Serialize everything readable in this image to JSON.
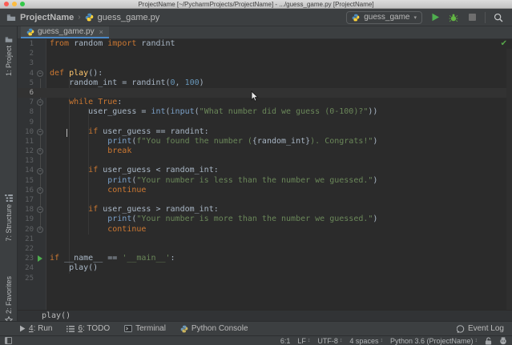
{
  "window": {
    "title": "ProjectName [~/PycharmProjects/ProjectName] - .../guess_game.py [ProjectName]"
  },
  "toolbar": {
    "project": "ProjectName",
    "separator": "›",
    "file": "guess_game.py",
    "run_config": "guess_game",
    "dropdown_caret": "▾"
  },
  "tabs": [
    {
      "label": "guess_game.py",
      "close": "×"
    }
  ],
  "left_bar": {
    "items": [
      "1: Project",
      "7: Structure",
      "2: Favorites"
    ]
  },
  "editor": {
    "caret_line": 6,
    "run_line": 23,
    "fold_start_lines": [
      4,
      7,
      10,
      14,
      18
    ],
    "fold_end_lines": [
      12,
      16,
      20
    ],
    "inspection_status": "✔",
    "breadcrumb": "play()",
    "lines": [
      {
        "tokens": [
          [
            "k",
            "from"
          ],
          [
            "t",
            " random "
          ],
          [
            "k",
            "import"
          ],
          [
            "t",
            " randint"
          ]
        ]
      },
      {
        "tokens": []
      },
      {
        "tokens": []
      },
      {
        "tokens": [
          [
            "k",
            "def"
          ],
          [
            "t",
            " "
          ],
          [
            "d",
            "play"
          ],
          [
            "t",
            "():"
          ]
        ]
      },
      {
        "tokens": [
          [
            "t",
            "    random_int = randint("
          ],
          [
            "n",
            "0"
          ],
          [
            "t",
            ", "
          ],
          [
            "n",
            "100"
          ],
          [
            "t",
            ")"
          ]
        ]
      },
      {
        "tokens": []
      },
      {
        "tokens": [
          [
            "t",
            "    "
          ],
          [
            "k",
            "while"
          ],
          [
            "t",
            " "
          ],
          [
            "k",
            "True"
          ],
          [
            "t",
            ":"
          ]
        ]
      },
      {
        "tokens": [
          [
            "t",
            "        user_guess = "
          ],
          [
            "b",
            "int"
          ],
          [
            "t",
            "("
          ],
          [
            "b",
            "input"
          ],
          [
            "t",
            "("
          ],
          [
            "s",
            "\"What number did we guess (0-100)?\""
          ],
          [
            "t",
            "))"
          ]
        ]
      },
      {
        "tokens": []
      },
      {
        "tokens": [
          [
            "t",
            "        "
          ],
          [
            "k",
            "if"
          ],
          [
            "t",
            " user_guess == randint:"
          ]
        ]
      },
      {
        "tokens": [
          [
            "t",
            "            "
          ],
          [
            "b",
            "print"
          ],
          [
            "t",
            "("
          ],
          [
            "s",
            "f\"You found the number ("
          ],
          [
            "f",
            "{random_int}"
          ],
          [
            "s",
            "). Congrats!\""
          ],
          [
            "t",
            ")"
          ]
        ]
      },
      {
        "tokens": [
          [
            "t",
            "            "
          ],
          [
            "k",
            "break"
          ]
        ]
      },
      {
        "tokens": []
      },
      {
        "tokens": [
          [
            "t",
            "        "
          ],
          [
            "k",
            "if"
          ],
          [
            "t",
            " user_guess < random_int:"
          ]
        ]
      },
      {
        "tokens": [
          [
            "t",
            "            "
          ],
          [
            "b",
            "print"
          ],
          [
            "t",
            "("
          ],
          [
            "s",
            "\"Your number is less than the number we guessed.\""
          ],
          [
            "t",
            ")"
          ]
        ]
      },
      {
        "tokens": [
          [
            "t",
            "            "
          ],
          [
            "k",
            "continue"
          ]
        ]
      },
      {
        "tokens": []
      },
      {
        "tokens": [
          [
            "t",
            "        "
          ],
          [
            "k",
            "if"
          ],
          [
            "t",
            " user_guess > random_int:"
          ]
        ]
      },
      {
        "tokens": [
          [
            "t",
            "            "
          ],
          [
            "b",
            "print"
          ],
          [
            "t",
            "("
          ],
          [
            "s",
            "\"Your number is more than the number we guessed.\""
          ],
          [
            "t",
            ")"
          ]
        ]
      },
      {
        "tokens": [
          [
            "t",
            "            "
          ],
          [
            "k",
            "continue"
          ]
        ]
      },
      {
        "tokens": []
      },
      {
        "tokens": []
      },
      {
        "tokens": [
          [
            "k",
            "if"
          ],
          [
            "t",
            " __name__ == "
          ],
          [
            "s",
            "'__main__'"
          ],
          [
            "t",
            ":"
          ]
        ]
      },
      {
        "tokens": [
          [
            "t",
            "    play()"
          ]
        ]
      },
      {
        "tokens": []
      }
    ]
  },
  "bottom_bar": {
    "items": [
      {
        "icon": "run-icon",
        "mnemonic": "4",
        "rest": ": Run"
      },
      {
        "icon": "todo-icon",
        "mnemonic": "6",
        "rest": ": TODO"
      },
      {
        "icon": "terminal-icon",
        "rest": "Terminal"
      },
      {
        "icon": "python-console-icon",
        "rest": "Python Console"
      }
    ],
    "right": {
      "icon": "event-log-icon",
      "label": "Event Log"
    }
  },
  "status_bar": {
    "items": [
      "6:1",
      "LF",
      "UTF-8",
      "4 spaces",
      "Python 3.6 (ProjectName)"
    ]
  },
  "icons": [
    "folder-icon",
    "python-icon",
    "dropdown-arrow-icon",
    "run-icon",
    "debug-icon",
    "stop-icon",
    "search-icon",
    "close-icon",
    "project-icon",
    "structure-icon",
    "favorites-icon",
    "fold-icon",
    "run-line-icon",
    "check-icon",
    "mouse-cursor-icon",
    "todo-icon",
    "terminal-icon",
    "python-console-icon",
    "event-log-icon",
    "updown-icon",
    "lock-icon",
    "inspector-icon",
    "toolwindow-switcher-icon"
  ],
  "colors": {
    "panel_bg": "#3C3F41",
    "editor_bg": "#2B2B2B",
    "gutter_bg": "#313335",
    "caret_row": "#323232",
    "text": "#A9B7C6",
    "keyword": "#CC7832",
    "string": "#6A8759",
    "number": "#6897BB",
    "builtin": "#7AA0C8",
    "function_def": "#FFC66D",
    "line_number": "#606366",
    "tab_underline": "#4A88C7",
    "run_green": "#4FAE4F",
    "debug_green": "#62B543"
  }
}
